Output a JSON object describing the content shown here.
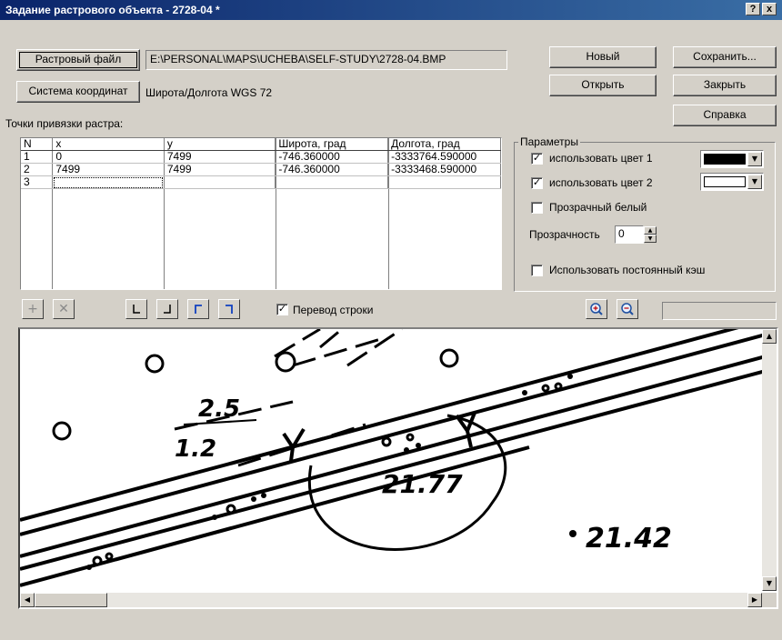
{
  "window": {
    "title": "Задание растрового объекта - 2728-04 *",
    "help_glyph": "?",
    "close_glyph": "x"
  },
  "raster": {
    "file_button": "Растровый файл",
    "file_path": "E:\\PERSONAL\\MAPS\\UCHEBA\\SELF-STUDY\\2728-04.BMP",
    "coord_button": "Система координат",
    "coord_value": "Широта/Долгота WGS 72"
  },
  "actions": {
    "new": "Новый",
    "open": "Открыть",
    "save": "Сохранить...",
    "close": "Закрыть",
    "help": "Справка"
  },
  "points": {
    "label": "Точки привязки растра:",
    "columns": [
      "N",
      "x",
      "y",
      "Широта, град",
      "Долгота, град"
    ],
    "rows": [
      [
        "1",
        "0",
        "7499",
        "-746.360000",
        "-3333764.590000"
      ],
      [
        "2",
        "7499",
        "7499",
        "-746.360000",
        "-3333468.590000"
      ],
      [
        "3",
        "",
        "",
        "",
        ""
      ]
    ]
  },
  "params": {
    "legend": "Параметры",
    "use_color1": "использовать цвет 1",
    "use_color1_checked": true,
    "color1": "#000000",
    "use_color2": "использовать цвет 2",
    "use_color2_checked": true,
    "color2": "#ffffff",
    "transparent_white": "Прозрачный белый",
    "transparent_white_checked": false,
    "transparency_label": "Прозрачность",
    "transparency_value": "0",
    "persistent_cache": "Использовать постоянный кэш",
    "persistent_cache_checked": false
  },
  "toolbar": {
    "line_wrap": "Перевод строки",
    "line_wrap_checked": true
  },
  "map": {
    "labels": [
      "2.5",
      "1.2",
      "21.77",
      "21.42"
    ]
  }
}
